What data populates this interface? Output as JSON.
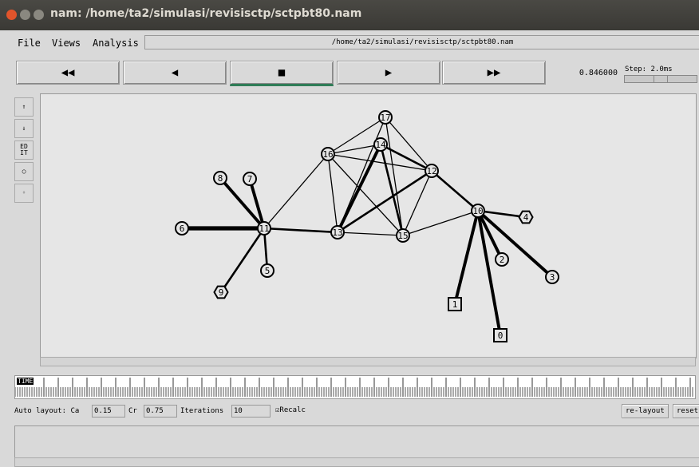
{
  "window": {
    "title": "nam: /home/ta2/simulasi/revisisctp/sctpbt80.nam"
  },
  "menu": {
    "file": "File",
    "views": "Views",
    "analysis": "Analysis",
    "path": "/home/ta2/simulasi/revisisctp/sctpbt80.nam"
  },
  "controls": {
    "rewind": "◀◀",
    "back": "◀",
    "stop": "■",
    "play": "▶",
    "fastforward": "▶▶",
    "time": "0.846000",
    "step_label": "Step: 2.0ms"
  },
  "tools": {
    "zoom_in": "⇑",
    "zoom_out": "⇓",
    "edit": "ED IT"
  },
  "timeline": {
    "label": "TIME"
  },
  "autolayout": {
    "label": "Auto layout: Ca",
    "ca": "0.15",
    "cr_label": "Cr",
    "cr": "0.75",
    "iter_label": "Iterations",
    "iterations": "10",
    "recalc": "Recalc",
    "relayout": "re-layout",
    "reset": "reset"
  },
  "nodes": [
    {
      "id": "0",
      "shape": "square"
    },
    {
      "id": "1",
      "shape": "square"
    },
    {
      "id": "2",
      "shape": "circle"
    },
    {
      "id": "3",
      "shape": "circle"
    },
    {
      "id": "4",
      "shape": "hexagon"
    },
    {
      "id": "5",
      "shape": "circle"
    },
    {
      "id": "6",
      "shape": "circle"
    },
    {
      "id": "7",
      "shape": "circle"
    },
    {
      "id": "8",
      "shape": "circle"
    },
    {
      "id": "9",
      "shape": "hexagon"
    },
    {
      "id": "10",
      "shape": "circle"
    },
    {
      "id": "11",
      "shape": "circle"
    },
    {
      "id": "12",
      "shape": "circle"
    },
    {
      "id": "13",
      "shape": "circle"
    },
    {
      "id": "14",
      "shape": "circle"
    },
    {
      "id": "15",
      "shape": "circle"
    },
    {
      "id": "16",
      "shape": "circle"
    },
    {
      "id": "17",
      "shape": "circle"
    }
  ]
}
